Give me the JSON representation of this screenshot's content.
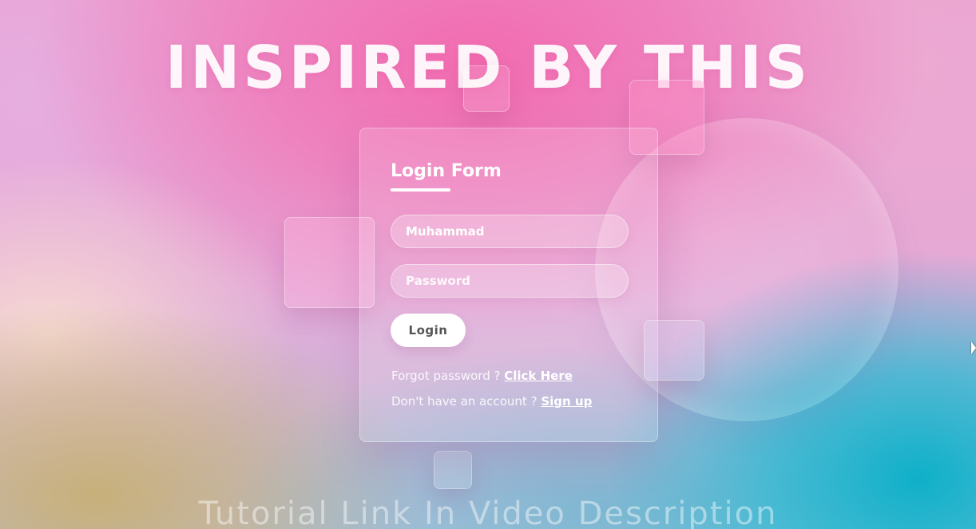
{
  "headline": "INSPIRED BY THIS",
  "login_form": {
    "title": "Login Form",
    "username_value": "Muhammad",
    "password_placeholder": "Password",
    "login_button": "Login",
    "forgot_text": "Forgot password ?",
    "forgot_link": "Click Here",
    "signup_text": "Don't have an account ?",
    "signup_link": "Sign up"
  },
  "footer_text": "Tutorial Link In Video Description",
  "colors": {
    "primary_pink": "#f26bb0",
    "teal": "#0fb0c9",
    "button_bg": "#ffffff",
    "button_text": "#555555"
  }
}
